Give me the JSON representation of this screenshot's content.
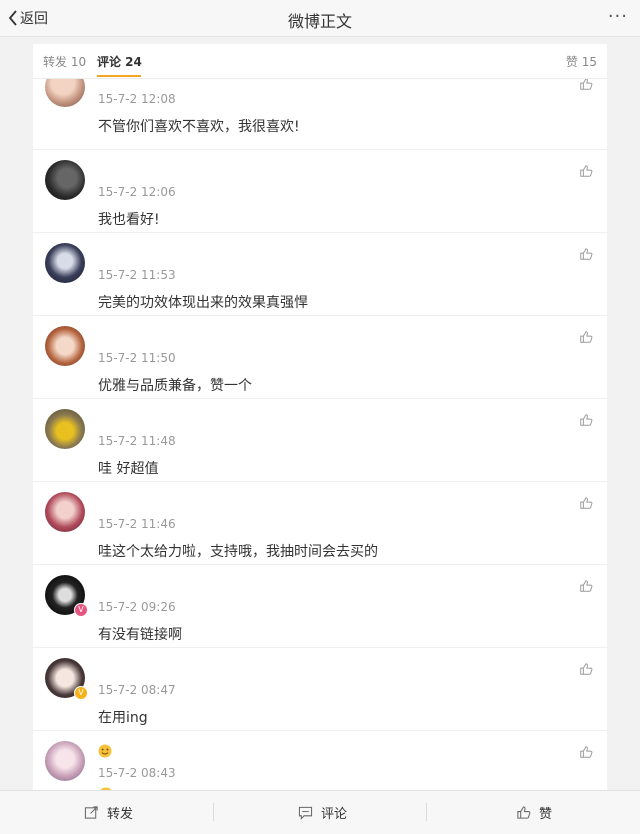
{
  "header": {
    "back_label": "返回",
    "title": "微博正文",
    "more": "···"
  },
  "tabs": {
    "repost": "转发 10",
    "comments": "评论 24",
    "likes": "赞 15"
  },
  "comments": [
    {
      "time": "15-7-2 12:08",
      "text": "不管你们喜欢不喜欢，我很喜欢!"
    },
    {
      "time": "15-7-2 12:06",
      "text": "我也看好!"
    },
    {
      "time": "15-7-2 11:53",
      "text": "完美的功效体现出来的效果真强悍"
    },
    {
      "time": "15-7-2 11:50",
      "text": "优雅与品质兼备，赞一个"
    },
    {
      "time": "15-7-2 11:48",
      "text": "哇 好超值"
    },
    {
      "time": "15-7-2 11:46",
      "text": "哇这个太给力啦，支持哦，我抽时间会去买的"
    },
    {
      "time": "15-7-2 09:26",
      "text": "有没有链接啊"
    },
    {
      "time": "15-7-2 08:47",
      "text": "在用ing"
    },
    {
      "time": "15-7-2 08:43",
      "text": ""
    }
  ],
  "badges": {
    "verified_v": "V"
  },
  "bottom": {
    "repost": "转发",
    "comment": "评论",
    "like": "赞"
  },
  "colors": {
    "accent": "#f5a623",
    "verified_pink": "#e6557f",
    "verified_yellow": "#f6b21a"
  }
}
